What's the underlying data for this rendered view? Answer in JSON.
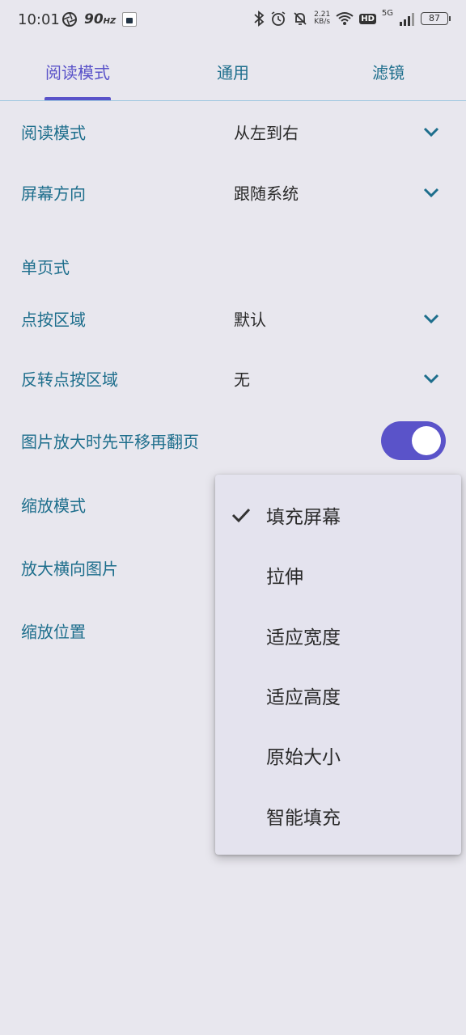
{
  "status_bar": {
    "time": "10:01",
    "refresh_rate": "90",
    "refresh_unit": "HZ",
    "net_speed_value": "2.21",
    "net_speed_unit": "KB/s",
    "hd_badge": "HD",
    "network_type": "5G",
    "battery": "87"
  },
  "tabs": [
    {
      "label": "阅读模式",
      "active": true
    },
    {
      "label": "通用",
      "active": false
    },
    {
      "label": "滤镜",
      "active": false
    }
  ],
  "settings": {
    "reading_mode": {
      "label": "阅读模式",
      "value": "从左到右"
    },
    "screen_orientation": {
      "label": "屏幕方向",
      "value": "跟随系统"
    },
    "section_single_page": "单页式",
    "tap_zones": {
      "label": "点按区域",
      "value": "默认"
    },
    "invert_tap_zones": {
      "label": "反转点按区域",
      "value": "无"
    },
    "pan_before_turn": {
      "label": "图片放大时先平移再翻页",
      "enabled": true
    },
    "scale_mode": {
      "label": "缩放模式"
    },
    "zoom_landscape": {
      "label": "放大横向图片"
    },
    "zoom_position": {
      "label": "缩放位置"
    }
  },
  "menu": {
    "selected_index": 0,
    "items": [
      "填充屏幕",
      "拉伸",
      "适应宽度",
      "适应高度",
      "原始大小",
      "智能填充"
    ]
  },
  "colors": {
    "accent": "#5a53c9",
    "label": "#1d6e8c",
    "background": "#e8e7ee"
  }
}
